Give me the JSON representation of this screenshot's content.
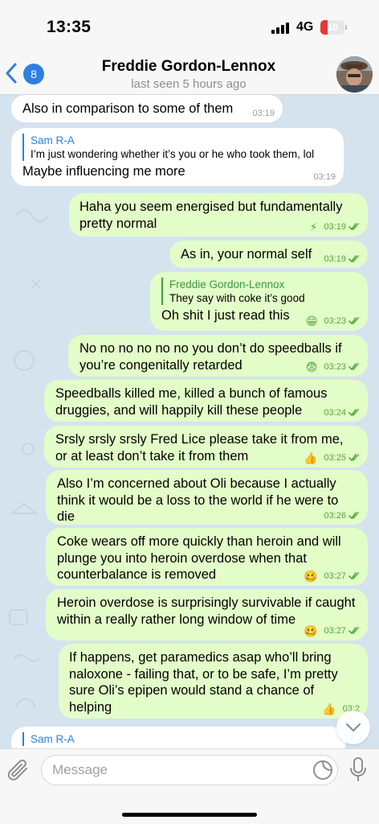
{
  "status_bar": {
    "time": "13:35",
    "network": "4G",
    "battery": "10",
    "battery_color": "#e53935"
  },
  "header": {
    "back_count": "8",
    "contact_name": "Freddie Gordon-Lennox",
    "last_seen": "last seen 5 hours ago",
    "avatar_icon": "profile-photo"
  },
  "messages": [
    {
      "direction": "in",
      "text": "Also in comparison to some of them",
      "time": "03:19"
    },
    {
      "direction": "in",
      "reply_name": "Sam R-A",
      "reply_text": "I’m just wondering whether it’s you or he who took them, lol",
      "text": "Maybe influencing me more",
      "time": "03:19"
    },
    {
      "direction": "out",
      "text": "Haha you seem energised but fundamentally pretty normal",
      "emoji": "⚡",
      "time": "03:19"
    },
    {
      "direction": "out",
      "text": "As in, your normal self",
      "time": "03:19"
    },
    {
      "direction": "out",
      "reply_name": "Freddie Gordon-Lennox",
      "reply_text": "They say with coke it’s good",
      "text": "Oh shit I just read this",
      "emoji": "😁",
      "time": "03:23"
    },
    {
      "direction": "out",
      "text": "No no no no no no you don’t do speedballs if you’re congenitally retarded",
      "emoji": "😨",
      "time": "03:23"
    },
    {
      "direction": "out",
      "text": "Speedballs killed me, killed a bunch of famous druggies, and will happily kill these people",
      "time": "03:24"
    },
    {
      "direction": "out",
      "text": "Srsly srsly srsly Fred Lice please take it from me, or at least don’t take it from them",
      "emoji": "👍",
      "time": "03:25"
    },
    {
      "direction": "out",
      "text": "Also I’m concerned about Oli because I actually think it would be a loss to the world if he were to die",
      "time": "03:26"
    },
    {
      "direction": "out",
      "text": "Coke wears off more quickly than heroin and will plunge you into heroin overdose when that counterbalance is removed",
      "emoji": "🥴",
      "time": "03:27"
    },
    {
      "direction": "out",
      "text": "Heroin overdose is surprisingly survivable if caught within a really rather long window of time",
      "emoji": "🥴",
      "time": "03:27"
    },
    {
      "direction": "out",
      "text": "If happens, get paramedics asap who’ll bring naloxone - failing that, or to be safe, I’m pretty sure Oli’s epipen would stand a chance of helping",
      "emoji": "👍",
      "time": "03:2"
    },
    {
      "direction": "in",
      "reply_name": "Sam R-A"
    }
  ],
  "input": {
    "placeholder": "Message"
  },
  "colors": {
    "accent": "#2f7fe0",
    "outgoing_bubble": "#e2fdc8",
    "incoming_bubble": "#ffffff",
    "chat_background": "#d5e3ee",
    "read_check": "#56a83c"
  }
}
